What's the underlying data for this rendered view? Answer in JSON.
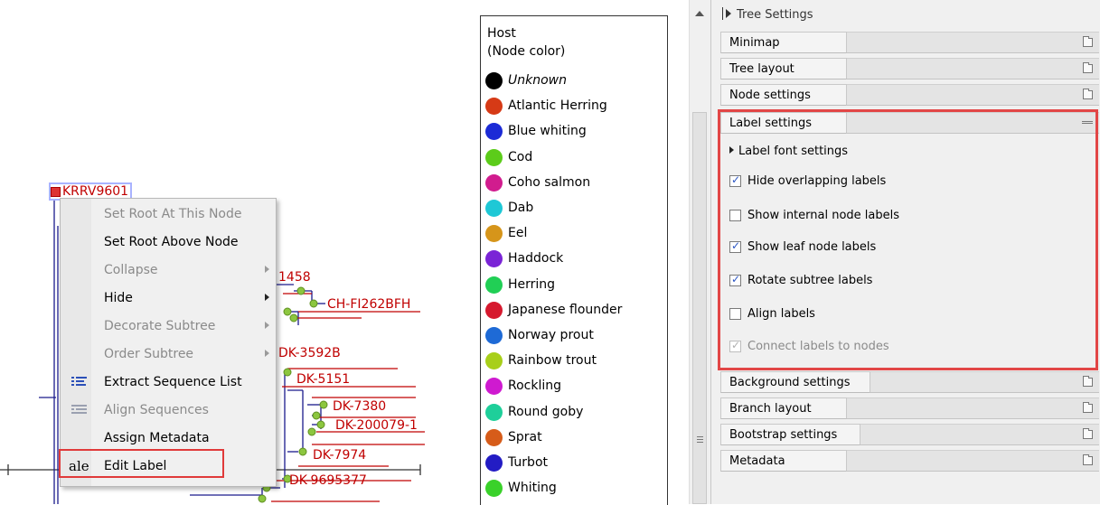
{
  "tree": {
    "root_label": "KRRV9601",
    "leaf_labels": [
      "1458",
      "CH-FI262BFH",
      "DK-3592B",
      "DK-5151",
      "DK-7380",
      "DK-200079-1",
      "DK-7974",
      "DK-9695377"
    ],
    "label_color": "#c00000",
    "node_color": "#8cc63f",
    "branch_color": "#1a1a8c"
  },
  "context_menu": {
    "items": [
      {
        "label": "Set Root At This Node",
        "enabled": false,
        "submenu": false,
        "icon": ""
      },
      {
        "label": "Set Root Above Node",
        "enabled": true,
        "submenu": false,
        "icon": ""
      },
      {
        "label": "Collapse",
        "enabled": false,
        "submenu": true,
        "icon": ""
      },
      {
        "label": "Hide",
        "enabled": true,
        "submenu": true,
        "icon": ""
      },
      {
        "label": "Decorate Subtree",
        "enabled": false,
        "submenu": true,
        "icon": ""
      },
      {
        "label": "Order Subtree",
        "enabled": false,
        "submenu": true,
        "icon": ""
      },
      {
        "label": "Extract Sequence List",
        "enabled": true,
        "submenu": false,
        "icon": "sequence-list-icon"
      },
      {
        "label": "Align Sequences",
        "enabled": false,
        "submenu": false,
        "icon": "align-sequences-icon"
      },
      {
        "label": "Assign Metadata",
        "enabled": true,
        "submenu": false,
        "icon": ""
      },
      {
        "label": "Edit Label",
        "enabled": true,
        "submenu": false,
        "icon": "edit-label-icon"
      }
    ],
    "edit_label_icon_text": "ale",
    "highlight_color": "#e03a3a"
  },
  "legend": {
    "title_line1": "Host",
    "title_line2": "(Node color)",
    "entries": [
      {
        "label": "Unknown",
        "color": "#000000",
        "italic": true
      },
      {
        "label": "Atlantic Herring",
        "color": "#d63a16",
        "italic": false
      },
      {
        "label": "Blue whiting",
        "color": "#1c2bd6",
        "italic": false
      },
      {
        "label": "Cod",
        "color": "#5ccc1a",
        "italic": false
      },
      {
        "label": "Coho salmon",
        "color": "#d11c8e",
        "italic": false
      },
      {
        "label": "Dab",
        "color": "#1ec8d6",
        "italic": false
      },
      {
        "label": "Eel",
        "color": "#d6951a",
        "italic": false
      },
      {
        "label": "Haddock",
        "color": "#7a24d6",
        "italic": false
      },
      {
        "label": "Herring",
        "color": "#21cf55",
        "italic": false
      },
      {
        "label": "Japanese flounder",
        "color": "#d6192e",
        "italic": false
      },
      {
        "label": "Norway prout",
        "color": "#1e6ad6",
        "italic": false
      },
      {
        "label": "Rainbow trout",
        "color": "#a8cf1a",
        "italic": false
      },
      {
        "label": "Rockling",
        "color": "#cf1ad0",
        "italic": false
      },
      {
        "label": "Round goby",
        "color": "#1ecf9a",
        "italic": false
      },
      {
        "label": "Sprat",
        "color": "#d65c1a",
        "italic": false
      },
      {
        "label": "Turbot",
        "color": "#231cc4",
        "italic": false
      },
      {
        "label": "Whiting",
        "color": "#3ad12a",
        "italic": false
      }
    ]
  },
  "panel": {
    "header": "Tree Settings",
    "sections": [
      {
        "label": "Minimap",
        "expanded": false
      },
      {
        "label": "Tree layout",
        "expanded": false
      },
      {
        "label": "Node settings",
        "expanded": false
      },
      {
        "label": "Label settings",
        "expanded": true
      },
      {
        "label": "Background settings",
        "expanded": false
      },
      {
        "label": "Branch layout",
        "expanded": false
      },
      {
        "label": "Bootstrap settings",
        "expanded": false
      },
      {
        "label": "Metadata",
        "expanded": false
      }
    ],
    "label_settings": {
      "font_settings": "Label font settings",
      "options": [
        {
          "label": "Hide overlapping labels",
          "checked": true,
          "enabled": true
        },
        {
          "label": "Show internal node labels",
          "checked": false,
          "enabled": true
        },
        {
          "label": "Show leaf node labels",
          "checked": true,
          "enabled": true
        },
        {
          "label": "Rotate subtree labels",
          "checked": true,
          "enabled": true
        },
        {
          "label": "Align labels",
          "checked": false,
          "enabled": true
        },
        {
          "label": "Connect labels to nodes",
          "checked": true,
          "enabled": false
        }
      ]
    },
    "highlight_color": "#e24646"
  }
}
